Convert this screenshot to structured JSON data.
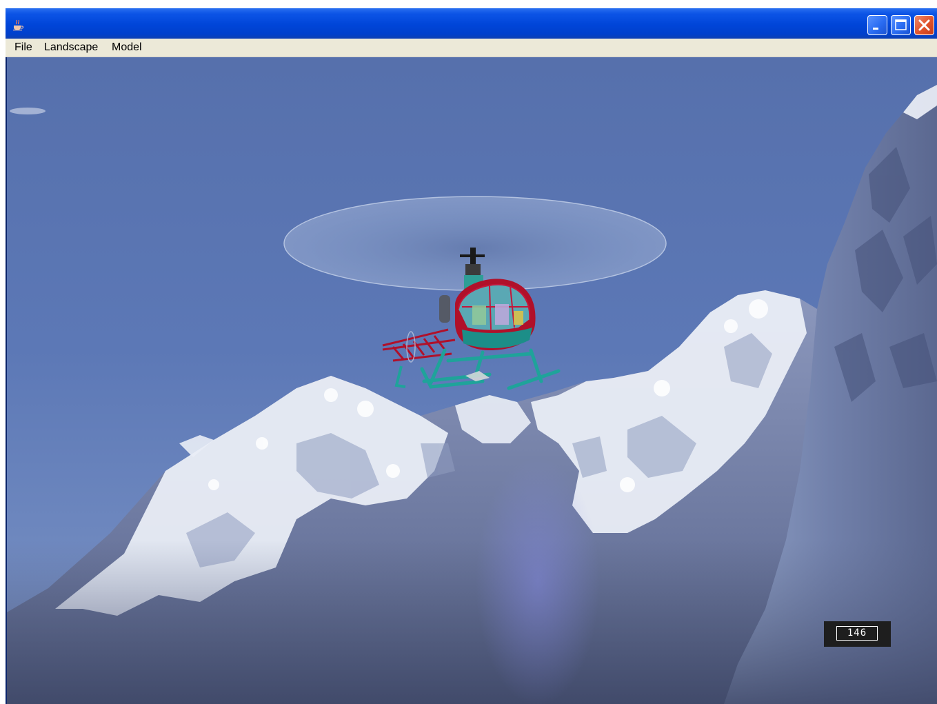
{
  "window": {
    "title": "",
    "controls": {
      "minimize_icon": "minimize-icon",
      "maximize_icon": "maximize-icon",
      "close_icon": "close-icon"
    }
  },
  "menu": {
    "items": [
      {
        "label": "File"
      },
      {
        "label": "Landscape"
      },
      {
        "label": "Model"
      }
    ]
  },
  "scene": {
    "subject": "helicopter",
    "colors": {
      "sky": "#5a76b0",
      "snow": "#e8ecf4",
      "rock": "#7a87ad",
      "fuselage": "#b0102a",
      "skids": "#1fa39a",
      "rotor_disc": "#8ea2c8"
    }
  },
  "hud": {
    "counter_value": "146"
  },
  "theme": {
    "titlebar_blue": "#0045d8",
    "close_red": "#e0522a",
    "menubar_bg": "#ece9d8"
  }
}
